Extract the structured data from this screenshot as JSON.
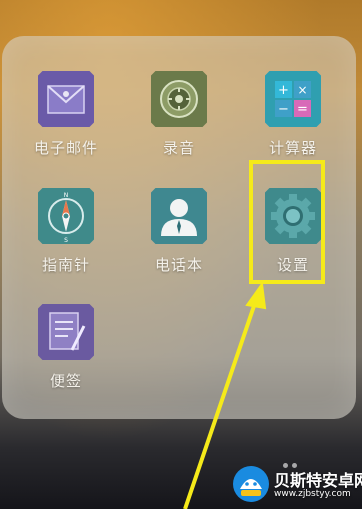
{
  "apps": [
    {
      "label": "电子邮件",
      "icon": "mail-icon",
      "color": "#6a5aa8"
    },
    {
      "label": "录音",
      "icon": "recorder-icon",
      "color": "#6b7a4a"
    },
    {
      "label": "计算器",
      "icon": "calculator-icon",
      "color": "#2f9fb0"
    },
    {
      "label": "指南针",
      "icon": "compass-icon",
      "color": "#3f8a8a"
    },
    {
      "label": "电话本",
      "icon": "contacts-icon",
      "color": "#3f8890"
    },
    {
      "label": "设置",
      "icon": "settings-gear-icon",
      "color": "#3f8a8c"
    },
    {
      "label": "便签",
      "icon": "notes-icon",
      "color": "#6a5aa0"
    }
  ],
  "annotation": {
    "highlight_color": "#f5ea1a",
    "highlighted_app": "设置"
  },
  "watermark": {
    "title": "贝斯特安卓网",
    "url": "www.zjbstyy.com"
  }
}
